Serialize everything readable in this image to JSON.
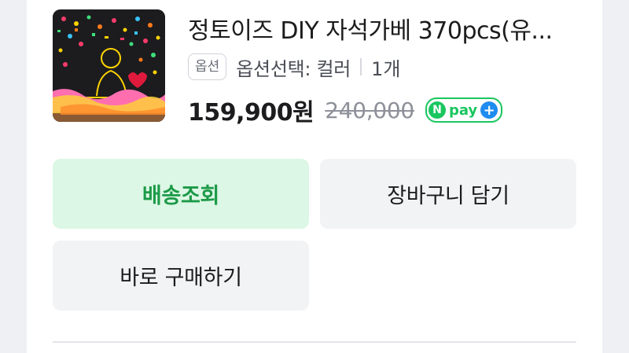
{
  "product": {
    "title": "정토이즈 DIY 자석가베 370pcs(유...",
    "option_tag": "옵션",
    "option_text": "옵션선택: 컬러",
    "quantity": "1개",
    "price": "159,900원",
    "original_price": "240,000",
    "npay_label": "pay",
    "npay_n": "N",
    "npay_plus": "+"
  },
  "actions": {
    "track_label": "배송조회",
    "cart_label": "장바구니 담기",
    "buy_label": "바로 구매하기"
  },
  "colors": {
    "track_bg": "#dcf7e5",
    "track_text": "#1c9a48",
    "npay_green": "#19c65f",
    "npay_blue": "#1e8cf0"
  }
}
